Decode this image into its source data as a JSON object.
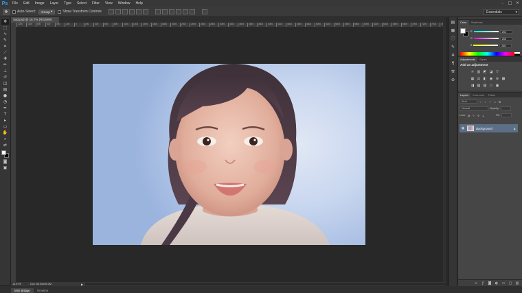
{
  "app": {
    "logo": "Ps"
  },
  "menu": [
    "File",
    "Edit",
    "Image",
    "Layer",
    "Type",
    "Select",
    "Filter",
    "View",
    "Window",
    "Help"
  ],
  "window_controls": {
    "minimize": "–",
    "maximize": "□",
    "close": "✕"
  },
  "options_bar": {
    "tool_icon": "move-icon",
    "auto_select_label": "Auto-Select:",
    "auto_select_value": "Group",
    "show_transform_label": "Show Transform Controls",
    "workspace": "Essentials"
  },
  "document": {
    "tab_title": "Sad.psd @ 16.7% (RGB/8#)"
  },
  "ruler_ticks": [
    "1200",
    "1000",
    "800",
    "600",
    "400",
    "200",
    "0",
    "200",
    "400",
    "600",
    "800",
    "1000",
    "1200",
    "1400",
    "1600",
    "1800",
    "2000",
    "2200",
    "2400",
    "2600",
    "2800",
    "3000",
    "3200",
    "3400",
    "3600",
    "3800",
    "4000",
    "4200",
    "4400",
    "4600",
    "4800",
    "5000",
    "5200",
    "5400",
    "5600",
    "5800",
    "6000",
    "6200",
    "6400",
    "6600",
    "6800",
    "7000",
    "7200",
    "7400",
    "7600"
  ],
  "status": {
    "zoom": "16.67%",
    "doc_info": "Doc: 65.3M/65.3M",
    "arrow": "▶"
  },
  "bottom_tabs": [
    "Mini Bridge",
    "Timeline"
  ],
  "color_panel": {
    "tabs": [
      "Color",
      "Swatches"
    ],
    "sliders": [
      {
        "label": "R",
        "value": "255",
        "color": "#ff3030"
      },
      {
        "label": "G",
        "value": "255",
        "color": "#30ff30"
      },
      {
        "label": "B",
        "value": "255",
        "color": "#3050ff"
      }
    ]
  },
  "adjustments_panel": {
    "tabs": [
      "Adjustments",
      "Styles"
    ],
    "title": "Add an adjustment"
  },
  "layers_panel": {
    "tabs": [
      "Layers",
      "Channels",
      "Paths"
    ],
    "kind_filter": "Kind",
    "blend_mode": "Normal",
    "opacity_label": "Opacity:",
    "lock_label": "Lock:",
    "fill_label": "Fill:",
    "layer_name": "Background"
  },
  "colors": {
    "accent": "#31a8ff",
    "foreground": "#ffffff",
    "background": "#000000",
    "selected_layer": "#5d6f86"
  }
}
